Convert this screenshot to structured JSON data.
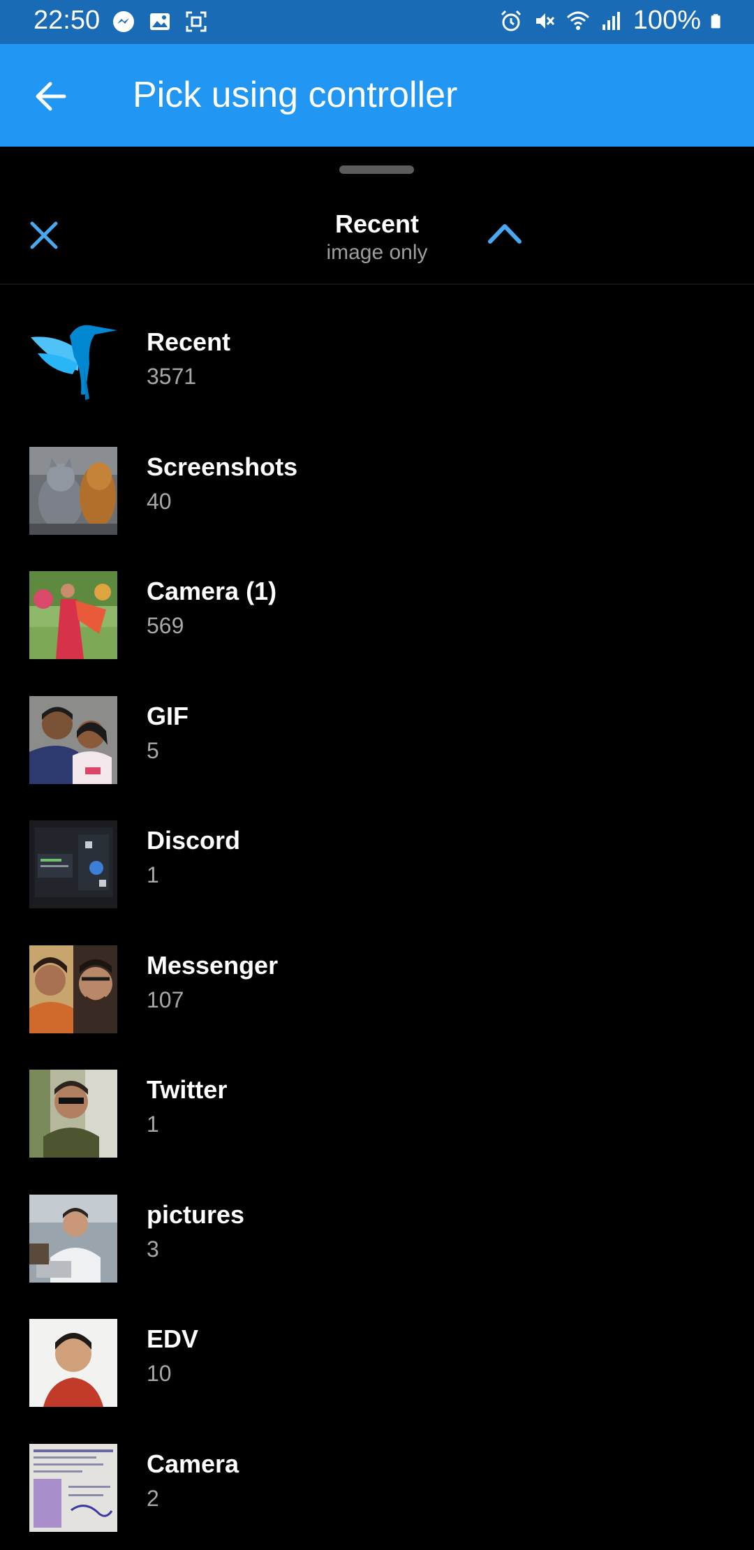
{
  "status_bar": {
    "time": "22:50",
    "battery": "100%",
    "icons_left": [
      "messenger-icon",
      "gallery-icon",
      "screenshot-icon"
    ],
    "icons_right": [
      "alarm-icon",
      "mute-icon",
      "wifi-icon",
      "signal-icon",
      "battery-icon"
    ]
  },
  "app_bar": {
    "title": "Pick using controller",
    "color": "#2196f3",
    "back_icon": "arrow-left-icon"
  },
  "sheet": {
    "title": "Recent",
    "subtitle": "image only",
    "close_icon": "close-icon",
    "collapse_icon": "chevron-up-icon",
    "accent": "#4aa8f0"
  },
  "albums": [
    {
      "name": "Recent",
      "count": "3571"
    },
    {
      "name": "Screenshots",
      "count": "40"
    },
    {
      "name": "Camera (1)",
      "count": "569"
    },
    {
      "name": "GIF",
      "count": "5"
    },
    {
      "name": "Discord",
      "count": "1"
    },
    {
      "name": "Messenger",
      "count": "107"
    },
    {
      "name": "Twitter",
      "count": "1"
    },
    {
      "name": "pictures",
      "count": "3"
    },
    {
      "name": "EDV",
      "count": "10"
    },
    {
      "name": "Camera",
      "count": "2"
    }
  ]
}
